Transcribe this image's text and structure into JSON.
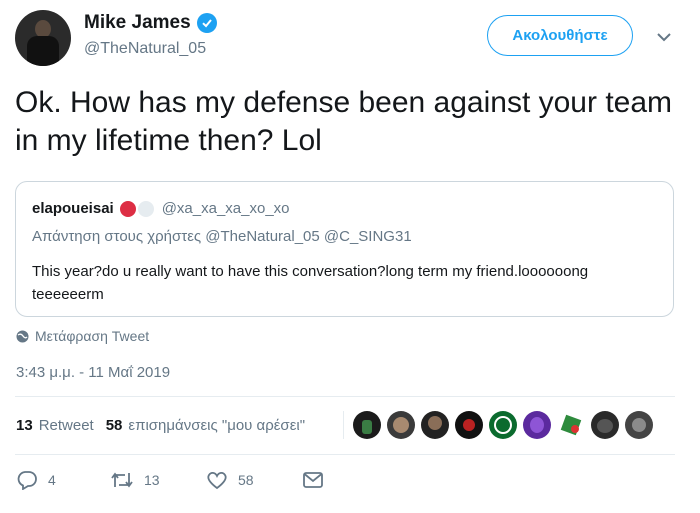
{
  "user": {
    "name": "Mike James",
    "handle": "@TheNatural_05",
    "follow_label": "Ακολουθήστε"
  },
  "tweet": {
    "text": "Ok. How has my defense been against your team in my lifetime then? Lol",
    "timestamp": "3:43 μ.μ. - 11 Μαΐ 2019"
  },
  "quote": {
    "author": "elapoueisai",
    "handle": "@xa_xa_xa_xo_xo",
    "reply_to": "Απάντηση στους χρήστες @TheNatural_05 @C_SING31",
    "text": "This year?do u really want to have this conversation?long term my friend.loooooong teeeeeerm"
  },
  "translate_label": "Μετάφραση Tweet",
  "stats": {
    "retweets_count": "13",
    "retweets_label": "Retweet",
    "likes_count": "58",
    "likes_label": "επισημάνσεις \"μου αρέσει\""
  },
  "actions": {
    "reply_count": "4",
    "retweet_count": "13",
    "like_count": "58"
  },
  "colors": {
    "accent": "#1da1f2",
    "muted": "#657786",
    "border": "#ccd6dd",
    "red_dot": "#e0245e",
    "gray_dot": "#e6ecf0"
  },
  "facepile": [
    "avatar-1",
    "avatar-2",
    "avatar-3",
    "avatar-4",
    "avatar-5",
    "avatar-6",
    "avatar-7",
    "avatar-8",
    "avatar-9"
  ]
}
